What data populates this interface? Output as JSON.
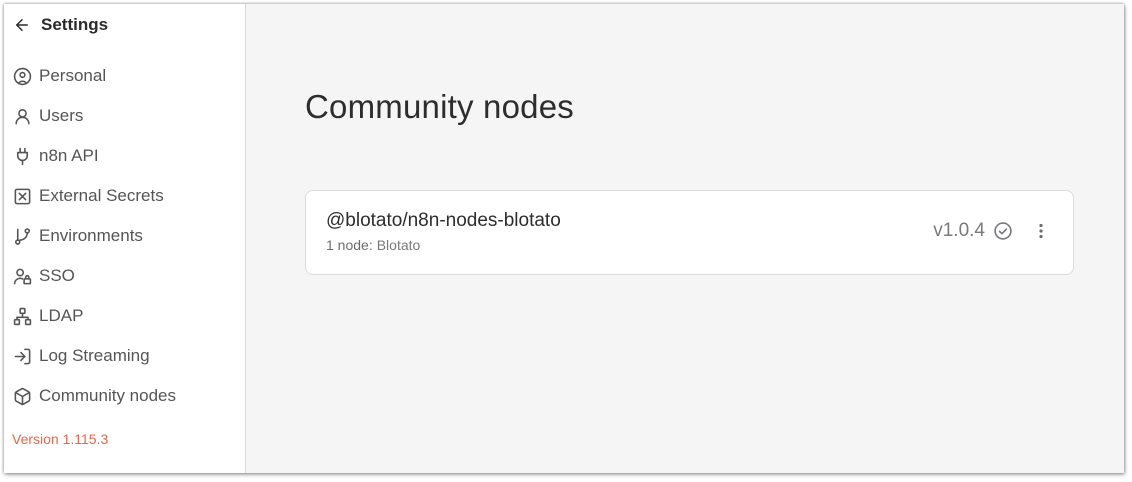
{
  "sidebar": {
    "title": "Settings",
    "items": [
      {
        "label": "Personal",
        "icon": "user-circle-icon"
      },
      {
        "label": "Users",
        "icon": "user-icon"
      },
      {
        "label": "n8n API",
        "icon": "plug-icon"
      },
      {
        "label": "External Secrets",
        "icon": "x-square-icon"
      },
      {
        "label": "Environments",
        "icon": "git-branch-icon"
      },
      {
        "label": "SSO",
        "icon": "user-lock-icon"
      },
      {
        "label": "LDAP",
        "icon": "network-icon"
      },
      {
        "label": "Log Streaming",
        "icon": "log-in-icon"
      },
      {
        "label": "Community nodes",
        "icon": "box-icon"
      }
    ],
    "version": "Version 1.115.3"
  },
  "main": {
    "title": "Community nodes",
    "packages": [
      {
        "name": "@blotato/n8n-nodes-blotato",
        "count_label": "1 node:",
        "nodes": "Blotato",
        "version": "v1.0.4"
      }
    ]
  },
  "colors": {
    "version_text": "#e8674a",
    "background": "#f5f5f6",
    "card_border": "#dcdcde"
  }
}
